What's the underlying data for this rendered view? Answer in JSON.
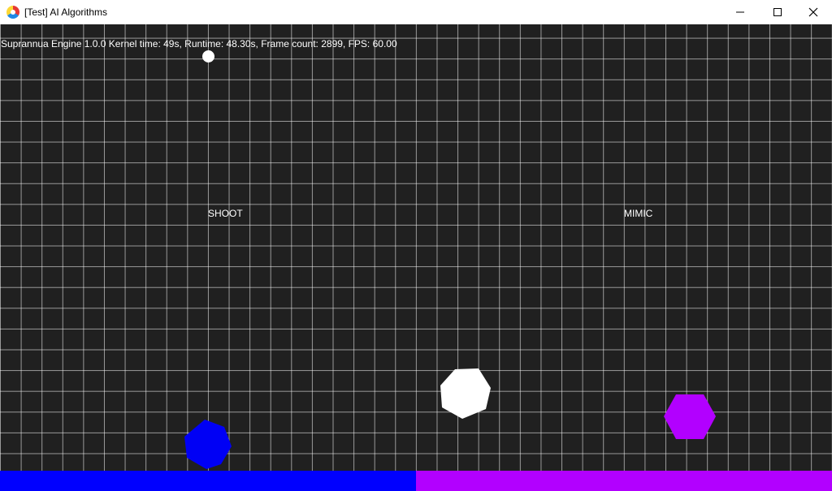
{
  "window": {
    "title": "[Test] AI Algorithms",
    "icon": "app-logo-icon"
  },
  "hud": {
    "text": "Suprannua Engine 1.0.0 Kernel time: 49s, Runtime: 48.30s, Frame count: 2899, FPS: 60.00"
  },
  "labels": {
    "shoot": "SHOOT",
    "mimic": "MIMIC"
  },
  "colors": {
    "background": "#202020",
    "grid": "#bfbfbf",
    "player_blue": "#0000ff",
    "player_purple": "#b200ff",
    "neutral": "#ffffff"
  }
}
